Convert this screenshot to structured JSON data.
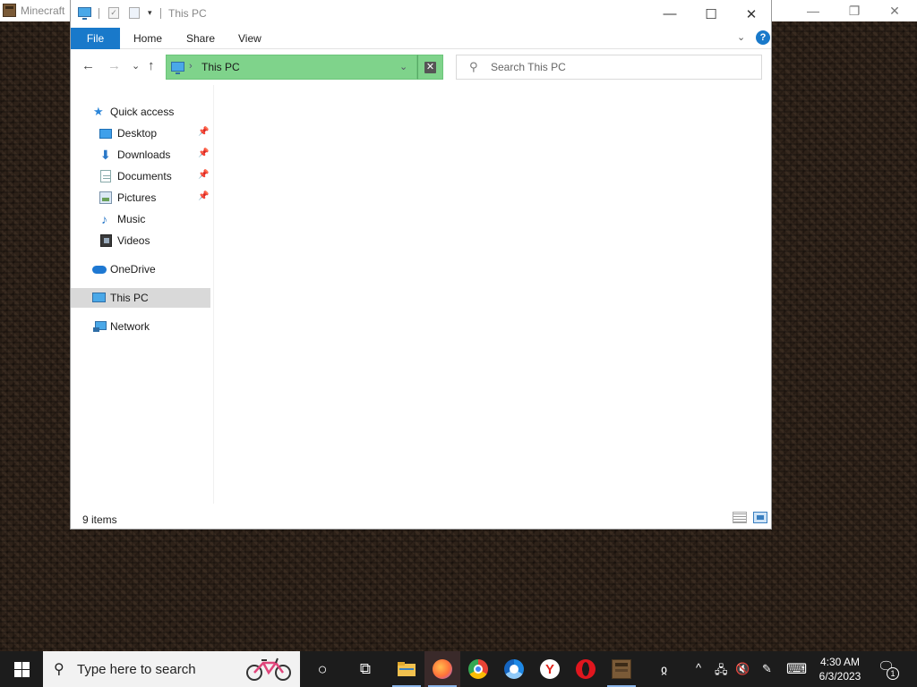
{
  "background_window": {
    "title": "Minecraft",
    "controls": {
      "minimize": "—",
      "restore": "❐",
      "close": "✕"
    }
  },
  "explorer": {
    "title": "This PC",
    "controls": {
      "minimize": "—",
      "maximize": "☐",
      "close": "✕"
    },
    "quick_access_toolbar": {
      "check_glyph": "✓",
      "dropdown_glyph": "▾"
    },
    "ribbon": {
      "tabs": [
        "File",
        "Home",
        "Share",
        "View"
      ],
      "expand_glyph": "⌄",
      "help_glyph": "?"
    },
    "nav": {
      "back": "←",
      "forward": "→",
      "recent": "⌄",
      "up": "↑"
    },
    "address": {
      "path": "This PC",
      "separator": "›",
      "dropdown_glyph": "⌄",
      "clear_glyph": "✕",
      "highlight_color": "#7fd38b"
    },
    "search": {
      "placeholder": "Search This PC",
      "icon_glyph": "⚲"
    },
    "nav_pane": {
      "quick_access_label": "Quick access",
      "pin_glyph": "📌",
      "quick_access_items": [
        {
          "label": "Desktop",
          "icon": "desktop-icon",
          "pinned": true
        },
        {
          "label": "Downloads",
          "icon": "downloads-icon",
          "pinned": true
        },
        {
          "label": "Documents",
          "icon": "documents-icon",
          "pinned": true
        },
        {
          "label": "Pictures",
          "icon": "pictures-icon",
          "pinned": true
        },
        {
          "label": "Music",
          "icon": "music-icon",
          "pinned": false
        },
        {
          "label": "Videos",
          "icon": "videos-icon",
          "pinned": false
        }
      ],
      "onedrive_label": "OneDrive",
      "this_pc_label": "This PC",
      "network_label": "Network",
      "selected": "This PC"
    },
    "status": {
      "item_count": "9 items"
    }
  },
  "taskbar": {
    "search_placeholder": "Type here to search",
    "search_glyph": "⚲",
    "cortana_glyph": "○",
    "task_view_glyph": "⧉",
    "pinned_apps": [
      {
        "name": "file-explorer",
        "color": "#f2c14e",
        "active": true
      },
      {
        "name": "firefox",
        "color": "#ff7139",
        "active": true
      },
      {
        "name": "chrome",
        "color": "#4caf50",
        "active": false
      },
      {
        "name": "chromium-browser",
        "color": "#1e88e5",
        "active": false
      },
      {
        "name": "yandex-browser",
        "color": "#ffffff",
        "active": false
      },
      {
        "name": "opera",
        "color": "#e0161e",
        "active": false
      },
      {
        "name": "minecraft-launcher",
        "color": "#7a5a37",
        "active": true
      }
    ],
    "yandex_letter": "Y",
    "tray": {
      "people_glyph": "ჲ",
      "chevron_glyph": "^",
      "network_glyph": "🖧",
      "volume_glyph": "🔇",
      "pen_glyph": "✎",
      "keyboard_glyph": "⌨"
    },
    "time": "4:30 AM",
    "date": "6/3/2023",
    "notifications_glyph": "🗨",
    "notifications_count": "1"
  }
}
